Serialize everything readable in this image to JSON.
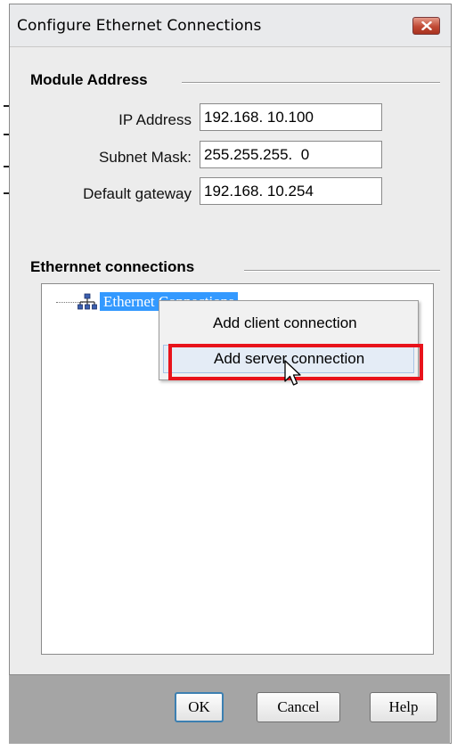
{
  "window": {
    "title": "Configure Ethernet Connections",
    "close_icon": "close-icon"
  },
  "module_address": {
    "heading": "Module Address",
    "fields": [
      {
        "label": "IP Address",
        "value": "192.168. 10.100"
      },
      {
        "label": "Subnet Mask:",
        "value": "255.255.255.  0"
      },
      {
        "label": "Default gateway",
        "value": "192.168. 10.254"
      }
    ]
  },
  "connections": {
    "heading": "Ethernnet connections",
    "tree_root": {
      "label": "Ethernet Connections",
      "icon": "network-icon",
      "selected": true
    }
  },
  "context_menu": {
    "items": [
      {
        "label": "Add client connection"
      },
      {
        "label": "Add server connection",
        "hovered": true
      }
    ]
  },
  "buttons": {
    "ok": "OK",
    "cancel": "Cancel",
    "help": "Help"
  },
  "colors": {
    "selection": "#3399ff",
    "highlight_box": "#e8131b",
    "close_button": "#c14a35"
  }
}
